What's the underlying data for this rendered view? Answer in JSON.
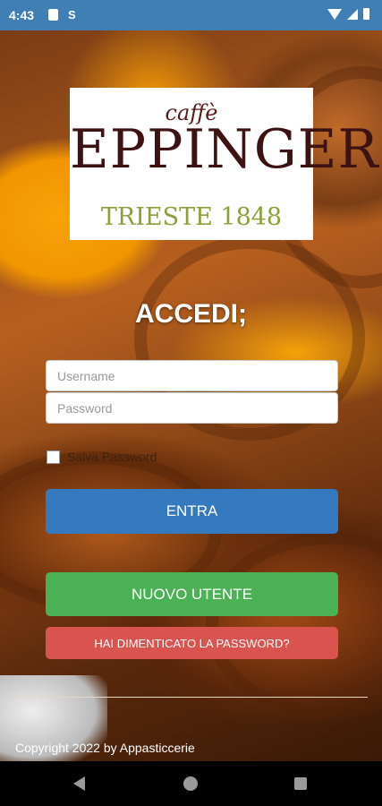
{
  "status_bar": {
    "time": "4:43",
    "notification_glyph": "S"
  },
  "logo": {
    "line1": "caffè",
    "line2": "EPPINGER",
    "line3": "TRIESTE 1848"
  },
  "login": {
    "title": "ACCEDI;",
    "username_placeholder": "Username",
    "password_placeholder": "Password",
    "remember_label": "Salva Password",
    "login_button": "ENTRA",
    "new_user_button": "NUOVO UTENTE",
    "forgot_button": "HAI DIMENTICATO LA PASSWORD?"
  },
  "footer": {
    "copyright": "Copyright 2022 by Appasticcerie"
  },
  "colors": {
    "status_bar": "#3f7fb4",
    "login_button": "#3579bf",
    "new_user_button": "#4bb155",
    "forgot_button": "#d9534f",
    "logo_brown": "#3d1212",
    "logo_green": "#8aa13a"
  }
}
